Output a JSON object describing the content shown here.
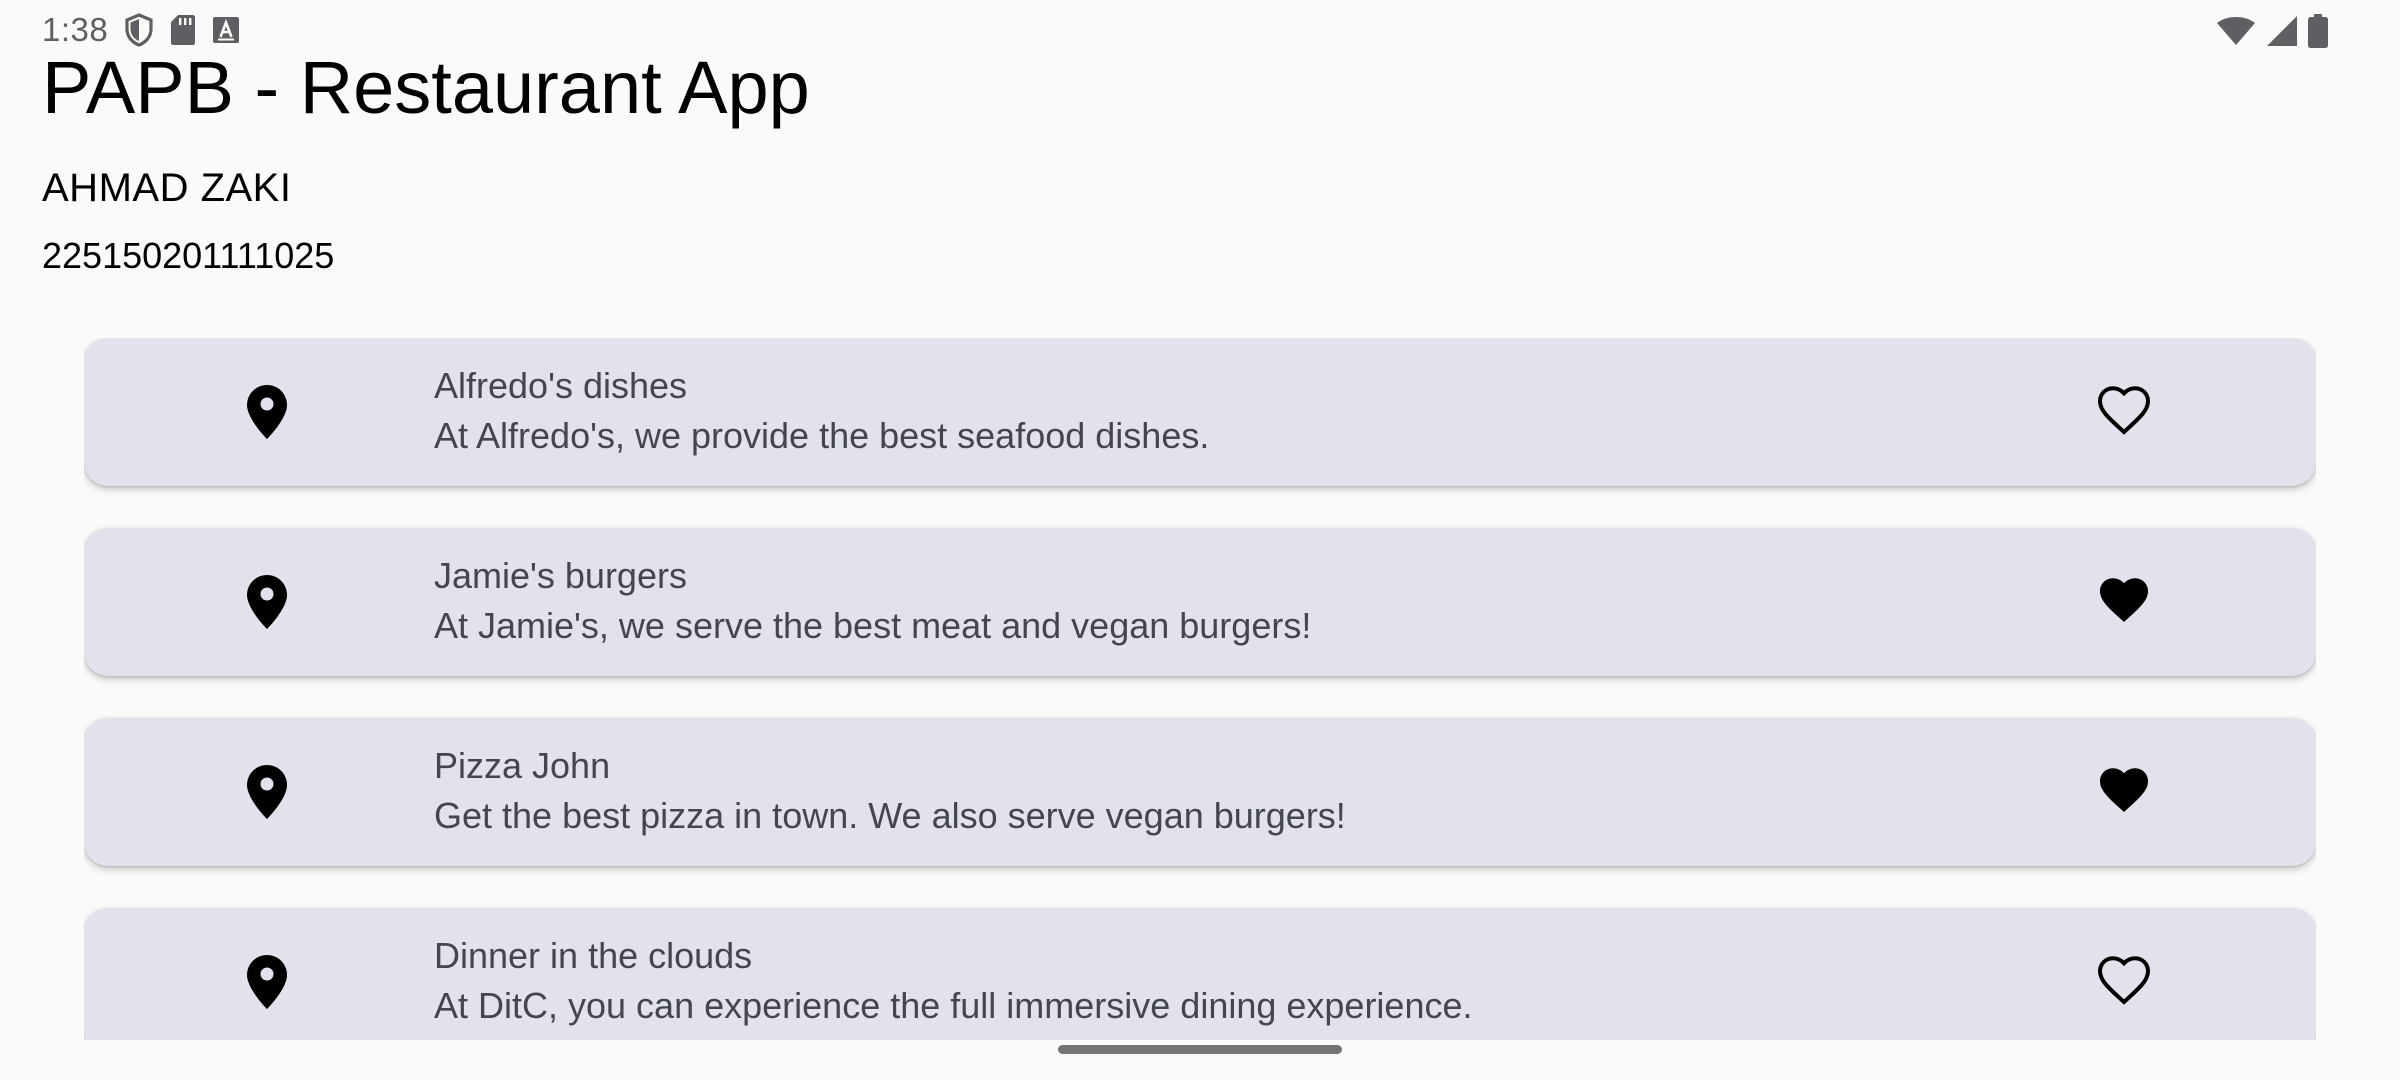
{
  "status_bar": {
    "time": "1:38",
    "left_icons": [
      "shield-icon",
      "sd-card-icon",
      "keyboard-a-icon"
    ],
    "right_icons": [
      "wifi-icon",
      "cell-signal-icon",
      "battery-icon"
    ]
  },
  "header": {
    "title": "PAPB - Restaurant App",
    "author_name": "AHMAD ZAKI",
    "student_id": "225150201111025"
  },
  "restaurants": [
    {
      "title": "Alfredo's dishes",
      "description": "At Alfredo's, we provide the best seafood dishes.",
      "favorite": false,
      "icon": "map-pin-icon"
    },
    {
      "title": "Jamie's burgers",
      "description": "At Jamie's, we serve the best meat and vegan burgers!",
      "favorite": true,
      "icon": "map-pin-icon"
    },
    {
      "title": "Pizza John",
      "description": "Get the best pizza in town. We also serve vegan burgers!",
      "favorite": true,
      "icon": "map-pin-icon"
    },
    {
      "title": "Dinner in the clouds",
      "description": "At DitC, you can experience the full immersive dining experience.",
      "favorite": false,
      "icon": "map-pin-icon"
    }
  ],
  "colors": {
    "background": "#fafafa",
    "card": "#e2e2ec",
    "card_text": "#44464f",
    "icon": "#000000"
  }
}
